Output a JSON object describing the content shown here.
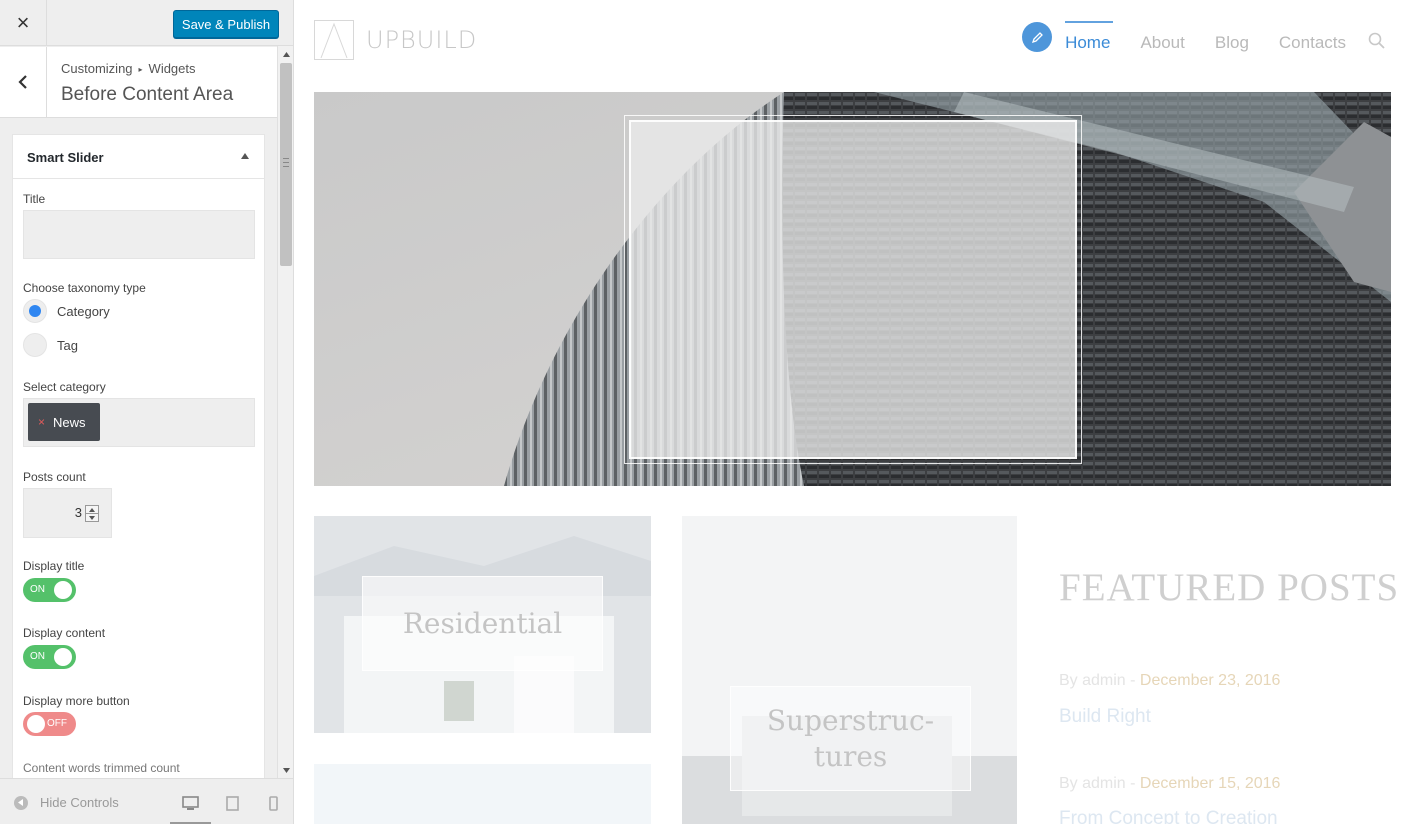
{
  "topbar": {
    "close_label": "×",
    "publish_label": "Save & Publish"
  },
  "section": {
    "breadcrumb_root": "Customizing",
    "breadcrumb_current": "Widgets",
    "title": "Before Content Area"
  },
  "widget": {
    "title": "Smart Slider",
    "title_field_label": "Title",
    "title_field_value": "",
    "taxonomy_label": "Choose taxonomy type",
    "taxonomy_options": [
      "Category",
      "Tag"
    ],
    "taxonomy_selected": "Category",
    "select_category_label": "Select category",
    "selected_category": "News",
    "tag_remove": "×",
    "posts_count_label": "Posts count",
    "posts_count": "3",
    "display_title_label": "Display title",
    "display_title_state": "ON",
    "display_content_label": "Display content",
    "display_content_state": "ON",
    "display_more_label": "Display more button",
    "display_more_state": "OFF",
    "trimmed_label": "Content words trimmed count"
  },
  "footer": {
    "hide_controls": "Hide Controls",
    "devices": [
      "desktop-icon",
      "tablet-icon",
      "mobile-icon"
    ]
  },
  "preview": {
    "logo": "UPBUILD",
    "nav": [
      "Home",
      "About",
      "Blog",
      "Contacts"
    ],
    "active_nav": "Home",
    "cards": [
      "Residential",
      "Superstruc-\ntures"
    ],
    "featured_heading": "FEATURED POSTS",
    "posts": [
      {
        "author_prefix": "By ",
        "author": "admin",
        "sep": " - ",
        "date": "December 23, 2016",
        "title": "Build Right"
      },
      {
        "author_prefix": "By ",
        "author": "admin",
        "sep": " - ",
        "date": "December 15, 2016",
        "title": "From Concept to Creation"
      }
    ]
  },
  "colors": {
    "primary_button": "#0085ba",
    "radio_selected": "#2f86f1",
    "switch_on": "#54c16a",
    "switch_off": "#ef8a8a",
    "nav_active": "#3b8bd7"
  }
}
